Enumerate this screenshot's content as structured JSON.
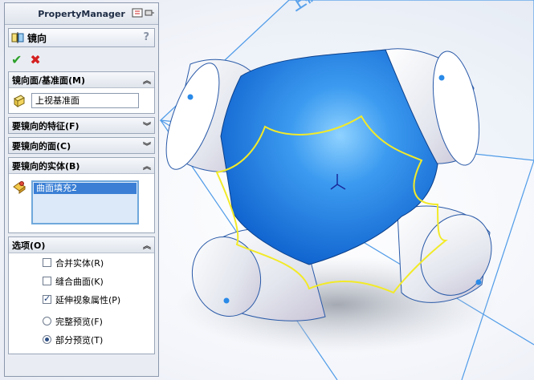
{
  "panel": {
    "title": "PropertyManager",
    "feature_title": "镜向",
    "help": "?",
    "ok_label": "✔",
    "cancel_label": "✖",
    "groups": {
      "mirror_face": {
        "label": "镜向面/基准面(M)",
        "selection": "上视基准面"
      },
      "features": {
        "label": "要镜向的特征(F)"
      },
      "faces": {
        "label": "要镜向的面(C)"
      },
      "bodies": {
        "label": "要镜向的实体(B)",
        "items": [
          "曲面填充2"
        ]
      },
      "options": {
        "label": "选项(O)",
        "merge_solids": "合并实体(R)",
        "knit_surfaces": "缝合曲面(K)",
        "propagate_visual": "延伸视象属性(P)",
        "full_preview": "完整预览(F)",
        "partial_preview": "部分预览(T)"
      }
    }
  },
  "viewport": {
    "plane_label": "上视基准面"
  },
  "colors": {
    "surface_blue": "#1a7be0",
    "edge_yellow": "#f2ea28",
    "plane_line": "#4f9be8"
  }
}
